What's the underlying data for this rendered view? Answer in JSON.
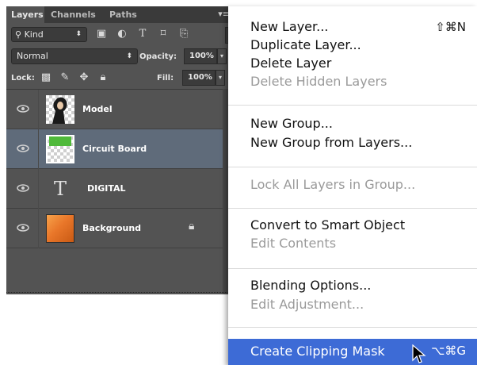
{
  "layers_panel": {
    "tabs": [
      "Layers",
      "Channels",
      "Paths"
    ],
    "panel_menu_icon": "panel-menu-icon",
    "filter": {
      "kind_label": "Kind",
      "kind_icon": "search-icon",
      "filter_icons": [
        "image-filter-icon",
        "adjustment-filter-icon",
        "type-filter-icon",
        "shape-filter-icon",
        "smart-object-filter-icon"
      ]
    },
    "blend_mode": "Normal",
    "opacity_label": "Opacity:",
    "opacity_value": "100%",
    "lock_label": "Lock:",
    "lock_icons": [
      "lock-transparency-icon",
      "lock-image-pixels-icon",
      "lock-position-icon",
      "lock-all-icon"
    ],
    "fill_label": "Fill:",
    "fill_value": "100%",
    "layers": [
      {
        "name": "Model",
        "visible": true,
        "selected": false,
        "thumb": "photo"
      },
      {
        "name": "Circuit Board",
        "visible": true,
        "selected": true,
        "thumb": "checker-green"
      },
      {
        "name": "DIGITAL",
        "visible": true,
        "selected": false,
        "thumb": "type"
      },
      {
        "name": "Background",
        "visible": true,
        "selected": false,
        "thumb": "orange",
        "locked": true
      }
    ]
  },
  "context_menu": {
    "groups": [
      [
        {
          "label": "New Layer...",
          "shortcut": "⇧⌘N",
          "enabled": true
        },
        {
          "label": "Duplicate Layer...",
          "enabled": true
        },
        {
          "label": "Delete Layer",
          "enabled": true
        },
        {
          "label": "Delete Hidden Layers",
          "enabled": false
        }
      ],
      [
        {
          "label": "New Group...",
          "enabled": true
        },
        {
          "label": "New Group from Layers...",
          "enabled": true
        }
      ],
      [
        {
          "label": "Lock All Layers in Group...",
          "enabled": false
        }
      ],
      [
        {
          "label": "Convert to Smart Object",
          "enabled": true
        },
        {
          "label": "Edit Contents",
          "enabled": false
        }
      ],
      [
        {
          "label": "Blending Options...",
          "enabled": true
        },
        {
          "label": "Edit Adjustment...",
          "enabled": false
        }
      ],
      [
        {
          "label": "Create Clipping Mask",
          "shortcut": "⌥⌘G",
          "enabled": true,
          "highlighted": true
        }
      ]
    ]
  },
  "colors": {
    "panel_bg": "#535353",
    "selected_layer": "#5f6b7a",
    "menu_highlight": "#3d6bd6",
    "disabled_text": "#9a9a9a"
  }
}
